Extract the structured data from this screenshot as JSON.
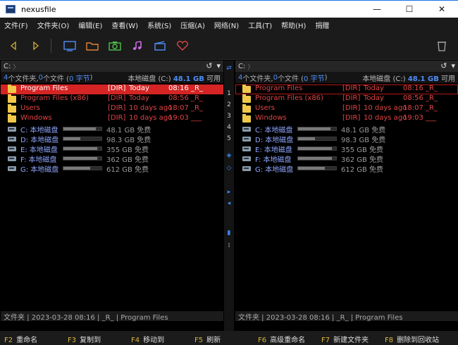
{
  "window": {
    "title": "nexusfile",
    "minimize": "—",
    "maximize": "☐",
    "close": "✕"
  },
  "menu": [
    "文件(F)",
    "文件夹(O)",
    "编辑(E)",
    "查看(W)",
    "系统(S)",
    "压缩(A)",
    "网络(N)",
    "工具(T)",
    "帮助(H)",
    "捐赠"
  ],
  "toolbar": [
    "back-icon",
    "forward-icon",
    "monitor-icon",
    "folder-icon",
    "camera-icon",
    "music-icon",
    "film-icon",
    "favorite-icon",
    "recycle-icon"
  ],
  "colors": {
    "accent": "#4f8ef7",
    "selection": "#d42424",
    "folder": "#f0c94a",
    "fkey": "#d9b63a"
  },
  "left": {
    "path": "C:",
    "chevron": "〉",
    "refresh": "↺",
    "menu": "▾",
    "info_count_dirs": "4",
    "info_text_dirs": " 个文件夹, ",
    "info_count_files": "0",
    "info_text_files": " 个文件 (",
    "info_bytes": "0 字节",
    "info_close": ")",
    "disk_label": "本地磁盘 (C:) ",
    "disk_free": "48.1 GB",
    "disk_suffix": " 可用",
    "folders": [
      {
        "name": "Program Files",
        "type": "[DIR]",
        "date": "Today",
        "time": "08:16",
        "attr": "_R_",
        "selected": true
      },
      {
        "name": "Program Files (x86)",
        "type": "[DIR]",
        "date": "Today",
        "time": "08:56",
        "attr": "_R_"
      },
      {
        "name": "Users",
        "type": "[DIR]",
        "date": "10 days ago",
        "time": "18:07",
        "attr": "_R_"
      },
      {
        "name": "Windows",
        "type": "[DIR]",
        "date": "10 days ago",
        "time": "19:03",
        "attr": "___"
      }
    ],
    "drives": [
      {
        "name": "C: 本地磁盘",
        "free": "48.1 GB 免费",
        "used": 0.85
      },
      {
        "name": "D: 本地磁盘",
        "free": "98.3 GB 免费",
        "used": 0.45
      },
      {
        "name": "E: 本地磁盘",
        "free": "355 GB 免费",
        "used": 0.88
      },
      {
        "name": "F: 本地磁盘",
        "free": "362 GB 免费",
        "used": 0.88
      },
      {
        "name": "G: 本地磁盘",
        "free": "612 GB 免费",
        "used": 0.7
      }
    ],
    "status": "文件夹 | 2023-03-28 08:16 | _R_ | Program Files"
  },
  "right": {
    "path": "C:",
    "chevron": "〉",
    "refresh": "↺",
    "menu": "▾",
    "info_count_dirs": "4",
    "info_text_dirs": " 个文件夹, ",
    "info_count_files": "0",
    "info_text_files": " 个文件 (",
    "info_bytes": "0 字节",
    "info_close": ")",
    "disk_label": "本地磁盘 (C:) ",
    "disk_free": "48.1 GB",
    "disk_suffix": " 可用",
    "folders": [
      {
        "name": "Program Files",
        "type": "[DIR]",
        "date": "Today",
        "time": "08:16",
        "attr": "_R_",
        "outlined": true
      },
      {
        "name": "Program Files (x86)",
        "type": "[DIR]",
        "date": "Today",
        "time": "08:56",
        "attr": "_R_"
      },
      {
        "name": "Users",
        "type": "[DIR]",
        "date": "10 days ago",
        "time": "18:07",
        "attr": "_R_"
      },
      {
        "name": "Windows",
        "type": "[DIR]",
        "date": "10 days ago",
        "time": "19:03",
        "attr": "___"
      }
    ],
    "drives": [
      {
        "name": "C: 本地磁盘",
        "free": "48.1 GB 免费",
        "used": 0.85
      },
      {
        "name": "D: 本地磁盘",
        "free": "98.3 GB 免费",
        "used": 0.45
      },
      {
        "name": "E: 本地磁盘",
        "free": "355 GB 免费",
        "used": 0.88
      },
      {
        "name": "F: 本地磁盘",
        "free": "362 GB 免费",
        "used": 0.88
      },
      {
        "name": "G: 本地磁盘",
        "free": "612 GB 免费",
        "used": 0.7
      }
    ],
    "status": "文件夹 | 2023-03-28 08:16 | _R_ | Program Files"
  },
  "middle": {
    "swap": "⇄",
    "numbers": [
      "1",
      "2",
      "3",
      "4",
      "5"
    ],
    "diamond_filled": "◈",
    "diamond_empty": "◇",
    "arrow_right": "▸",
    "arrow_left": "◂",
    "bars": "▮",
    "grip": "⁞"
  },
  "fkeys": [
    {
      "key": "F2",
      "label": "重命名"
    },
    {
      "key": "F3",
      "label": "复制到"
    },
    {
      "key": "F4",
      "label": "移动到"
    },
    {
      "key": "F5",
      "label": "刷新"
    },
    {
      "key": "F6",
      "label": "高级重命名"
    },
    {
      "key": "F7",
      "label": "新建文件夹"
    },
    {
      "key": "F8",
      "label": "删除到回收站"
    }
  ]
}
